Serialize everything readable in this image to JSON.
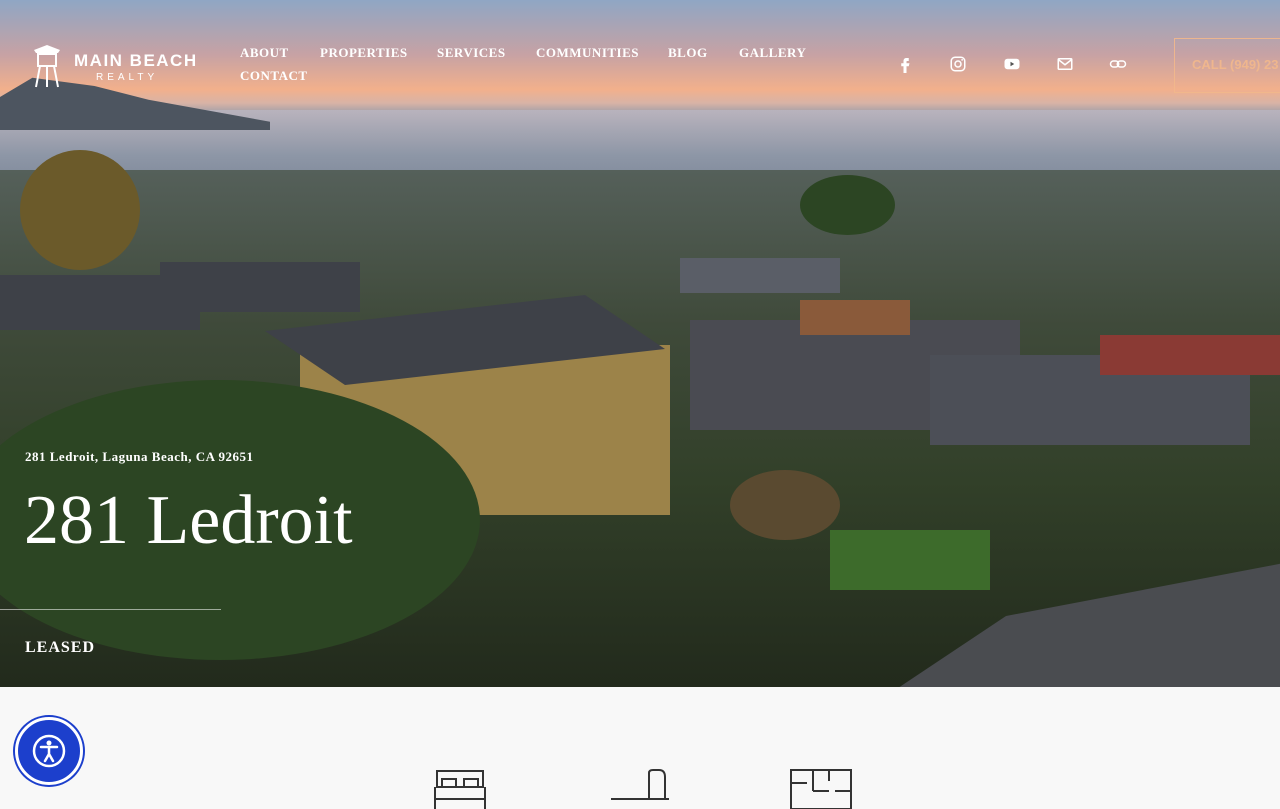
{
  "brand": {
    "name": "MAIN BEACH",
    "sub": "REALTY"
  },
  "nav": {
    "items": [
      "ABOUT",
      "PROPERTIES",
      "SERVICES",
      "COMMUNITIES",
      "BLOG",
      "GALLERY",
      "CONTACT"
    ]
  },
  "social": [
    "facebook-icon",
    "instagram-icon",
    "youtube-icon",
    "email-icon",
    "link-icon"
  ],
  "cta": {
    "label": "CALL (949) 23"
  },
  "property": {
    "address": "281 Ledroit, Laguna Beach, CA 92651",
    "title": "281 Ledroit",
    "status": "LEASED"
  },
  "features": [
    "bed-icon",
    "bath-icon",
    "floorplan-icon"
  ],
  "accessibility": {
    "icon": "accessibility-icon",
    "color": "#1c3fcc"
  }
}
